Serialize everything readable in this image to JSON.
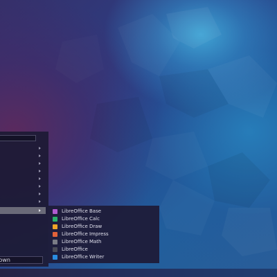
{
  "launcher": {
    "search_value": "",
    "category_count": 10,
    "selected_category_index": 9,
    "power_label": "own"
  },
  "submenu": {
    "items": [
      {
        "label": "LibreOffice Base",
        "icon": "libreoffice-base-icon",
        "color": "#b05ad0"
      },
      {
        "label": "LibreOffice Calc",
        "icon": "libreoffice-calc-icon",
        "color": "#29b06a"
      },
      {
        "label": "LibreOffice Draw",
        "icon": "libreoffice-draw-icon",
        "color": "#f0a428"
      },
      {
        "label": "LibreOffice Impress",
        "icon": "libreoffice-impress-icon",
        "color": "#e2623a"
      },
      {
        "label": "LibreOffice Math",
        "icon": "libreoffice-math-icon",
        "color": "#7a7c86"
      },
      {
        "label": "LibreOffice",
        "icon": "libreoffice-icon",
        "color": "#4a4c58"
      },
      {
        "label": "LibreOffice Writer",
        "icon": "libreoffice-writer-icon",
        "color": "#2a8ce0"
      }
    ]
  },
  "colors": {
    "menu_background": "#1e1c38",
    "highlight": "#6a6a78",
    "text": "#e0e0ec"
  }
}
